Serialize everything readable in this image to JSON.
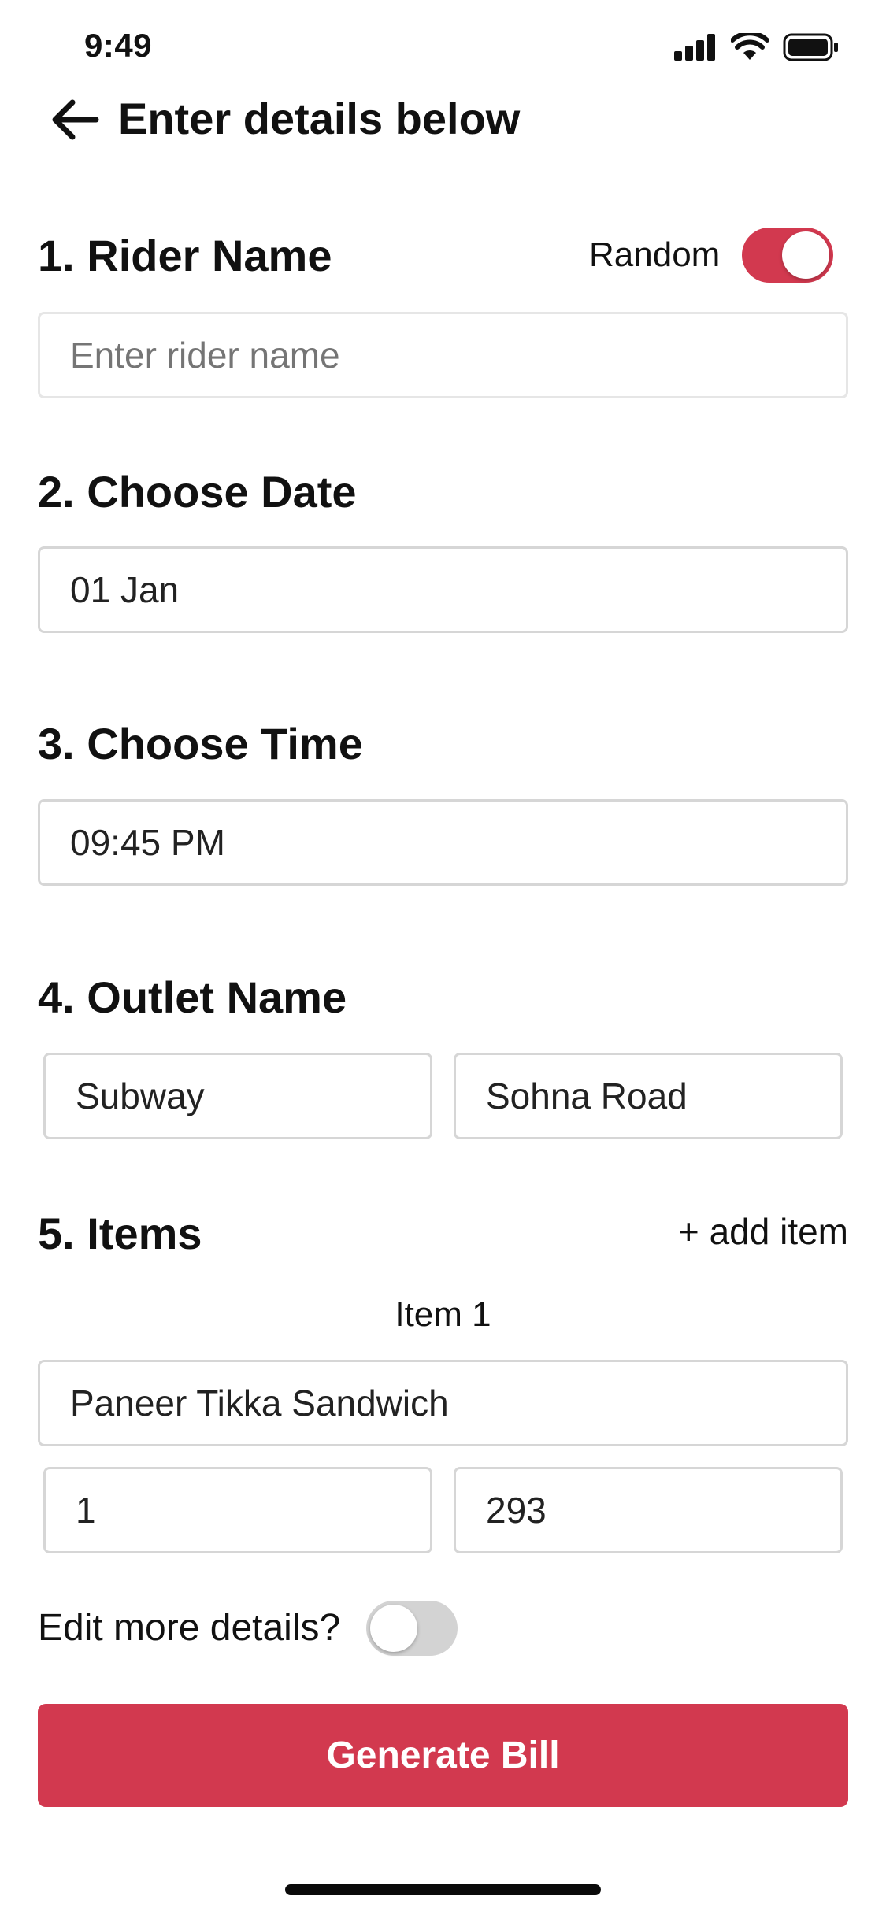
{
  "status_bar": {
    "time": "9:49",
    "icons": [
      "signal-icon",
      "wifi-icon",
      "battery-icon"
    ]
  },
  "header": {
    "back_icon": "arrow-left-icon",
    "title": "Enter details below"
  },
  "sections": {
    "rider": {
      "heading": "1. Rider Name",
      "random_label": "Random",
      "random_enabled": true,
      "placeholder": "Enter rider name",
      "value": ""
    },
    "date": {
      "heading": "2. Choose Date",
      "value": "01 Jan"
    },
    "time": {
      "heading": "3. Choose Time",
      "value": "09:45 PM"
    },
    "outlet": {
      "heading": "4. Outlet Name",
      "name": "Subway",
      "location": "Sohna Road"
    },
    "items": {
      "heading": "5. Items",
      "add_label": "+ add item",
      "list": [
        {
          "label": "Item 1",
          "name": "Paneer Tikka Sandwich",
          "quantity": "1",
          "price": "293"
        }
      ]
    }
  },
  "edit_more": {
    "label": "Edit more details?",
    "enabled": false
  },
  "generate_button": {
    "label": "Generate Bill"
  },
  "colors": {
    "accent": "#d2394f",
    "border": "#d6d6d6",
    "toggle_off": "#d3d3d3"
  }
}
